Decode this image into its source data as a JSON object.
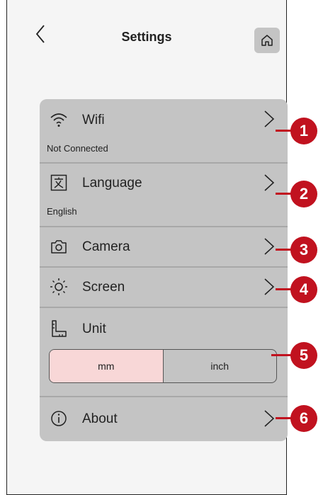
{
  "header": {
    "title": "Settings",
    "back_icon": "chevron-left-icon",
    "home_icon": "home-icon"
  },
  "settings": {
    "wifi": {
      "label": "Wifi",
      "status": "Not Connected",
      "icon": "wifi-icon"
    },
    "language": {
      "label": "Language",
      "value": "English",
      "icon": "language-icon"
    },
    "camera": {
      "label": "Camera",
      "icon": "camera-icon"
    },
    "screen": {
      "label": "Screen",
      "icon": "brightness-icon"
    },
    "unit": {
      "label": "Unit",
      "icon": "ruler-icon",
      "options": [
        "mm",
        "inch"
      ],
      "selected": "mm"
    },
    "about": {
      "label": "About",
      "icon": "info-icon"
    }
  },
  "callouts": [
    "1",
    "2",
    "3",
    "4",
    "5",
    "6"
  ],
  "colors": {
    "panel": "#c4c4c4",
    "selected_option": "#f8d7d7",
    "callout": "#c1121f"
  }
}
